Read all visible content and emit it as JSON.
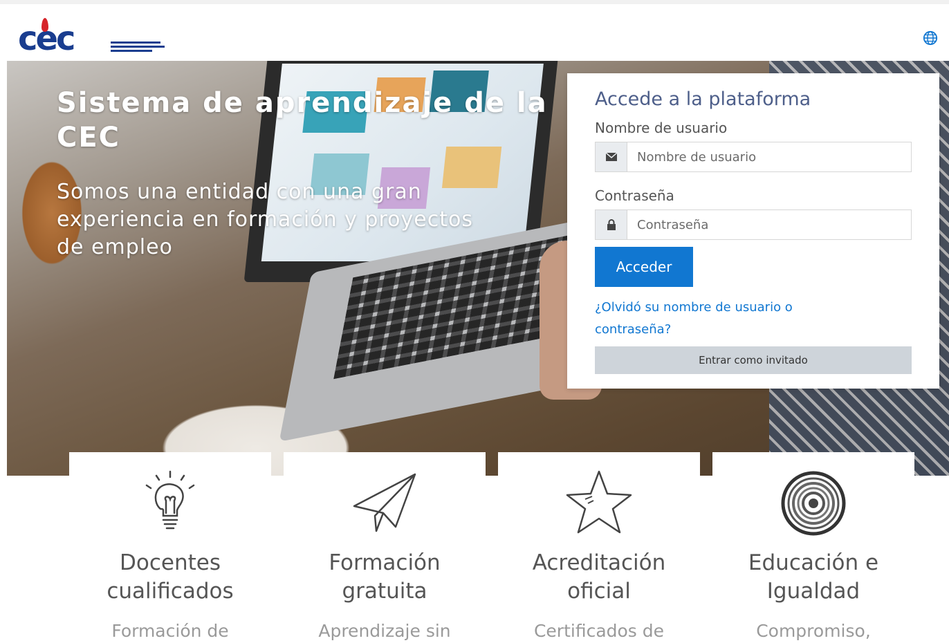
{
  "header": {
    "logo_text": "cec",
    "logo_alt": "CEC logo",
    "language_icon": "globe-icon"
  },
  "hero": {
    "title": "Sistema de aprendizaje de la CEC",
    "subtitle": "Somos una entidad con una gran experiencia en formación y proyectos de empleo"
  },
  "login": {
    "heading": "Accede a la plataforma",
    "username_label": "Nombre de usuario",
    "username_placeholder": "Nombre de usuario",
    "username_value": "",
    "password_label": "Contraseña",
    "password_placeholder": "Contraseña",
    "password_value": "",
    "submit_label": "Acceder",
    "forgot_link": "¿Olvidó su nombre de usuario o contraseña?",
    "guest_label": "Entrar como invitado"
  },
  "features": [
    {
      "title": "Docentes cualificados",
      "desc": "Formación de",
      "icon": "lightbulb-icon"
    },
    {
      "title": "Formación gratuita",
      "desc": "Aprendizaje sin",
      "icon": "paper-plane-icon"
    },
    {
      "title": "Acreditación oficial",
      "desc": "Certificados de",
      "icon": "star-icon"
    },
    {
      "title": "Educación e Igualdad",
      "desc": "Compromiso,",
      "icon": "target-icon"
    }
  ],
  "colors": {
    "brand_blue": "#1a3d8f",
    "primary_button": "#1177d1",
    "guest_button": "#ced4da",
    "heading": "#4e5f8a"
  }
}
